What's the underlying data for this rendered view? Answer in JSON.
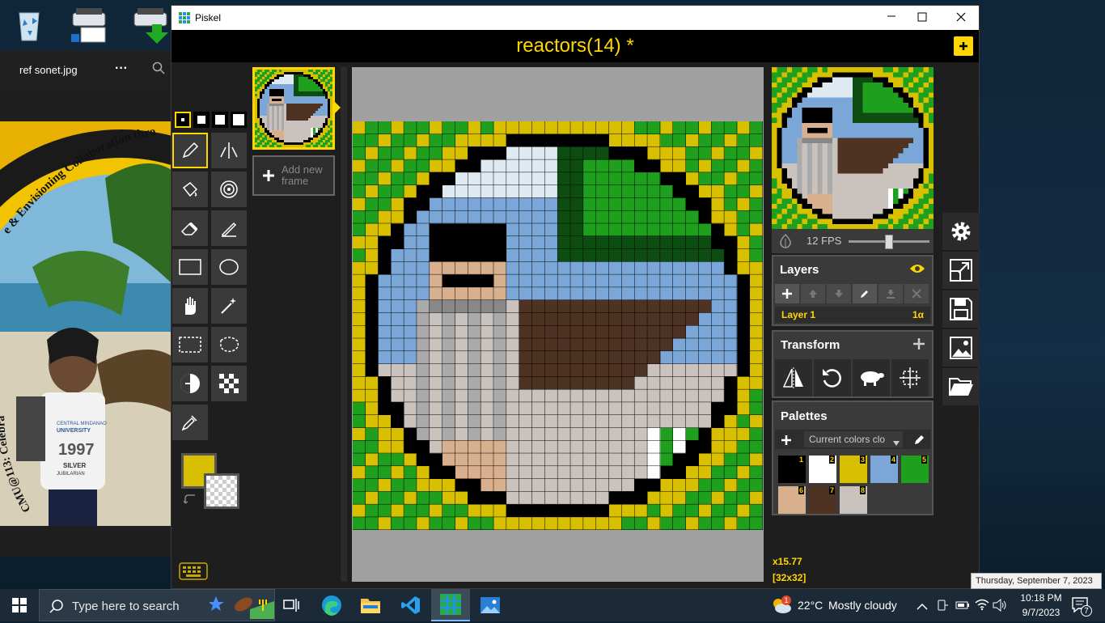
{
  "window": {
    "app_name": "Piskel",
    "document_title": "reactors(14) *"
  },
  "viewer": {
    "file_name": "ref sonet.jpg",
    "more_label": "···"
  },
  "photo": {
    "arc_text_top": "e & Envisioning Collaboration thro",
    "arc_text_left": "CMU@113: Celebra",
    "shirt_text_1": "CENTRAL MINDANAO",
    "shirt_text_2": "UNIVERSITY",
    "shirt_text_3": "1997",
    "shirt_text_4": "SILVER",
    "shirt_text_5": "JUBILARIAN"
  },
  "frames": {
    "add_label": "Add new frame"
  },
  "preview": {
    "fps_label": "12 FPS",
    "fps_value": 12,
    "fps_slider_fraction": 0.5
  },
  "layers": {
    "title": "Layers",
    "items": [
      {
        "name": "Layer 1",
        "opacity": "1α"
      }
    ]
  },
  "transform": {
    "title": "Transform"
  },
  "palettes": {
    "title": "Palettes",
    "selected": "Current colors clo",
    "swatches": [
      {
        "n": "1",
        "color": "#000000"
      },
      {
        "n": "2",
        "color": "#ffffff"
      },
      {
        "n": "3",
        "color": "#d8c000"
      },
      {
        "n": "4",
        "color": "#7aa7d8"
      },
      {
        "n": "5",
        "color": "#1ea01e"
      },
      {
        "n": "6",
        "color": "#d9b08e"
      },
      {
        "n": "7",
        "color": "#4e3323"
      },
      {
        "n": "8",
        "color": "#c9c2bd"
      }
    ]
  },
  "status": {
    "zoom": "x15.77",
    "size": "[32x32]"
  },
  "colors": {
    "primary": "#d8c000",
    "accent": "#ffd700"
  },
  "taskbar": {
    "search_placeholder": "Type here to search",
    "weather_temp": "22°C",
    "weather_text": "Mostly cloudy",
    "weather_badge": "1",
    "time": "10:18 PM",
    "date": "9/7/2023",
    "tooltip": "Thursday, September 7, 2023",
    "notif_count": "7"
  }
}
